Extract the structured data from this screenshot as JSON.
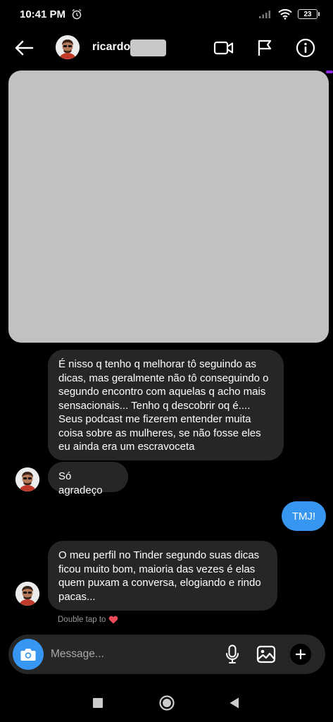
{
  "status_bar": {
    "time": "10:41 PM",
    "battery": "23",
    "icons": [
      "alarm-icon",
      "signal-icon",
      "wifi-icon",
      "battery-icon"
    ]
  },
  "header": {
    "contact_name": "ricardo",
    "icons": [
      "back-arrow-icon",
      "video-call-icon",
      "flag-icon",
      "info-icon"
    ]
  },
  "messages": [
    {
      "from": "contact",
      "text": "É nisso q tenho q melhorar tô seguindo as dicas, mas geralmente não tô conseguindo o segundo encontro com aquelas q acho mais sensacionais... Tenho q descobrir oq é.... Seus podcast me fizerem entender muita coisa sobre as mulheres, se não fosse eles eu ainda era um escravoceta"
    },
    {
      "from": "contact",
      "text": "Só agradeço"
    },
    {
      "from": "me",
      "text": "TMJ!"
    },
    {
      "from": "contact",
      "text": "O meu perfil no Tinder segundo suas dicas ficou muito bom, maioria das vezes é elas quem puxam a conversa, elogiando e rindo pacas..."
    }
  ],
  "hint": {
    "text": "Double tap to",
    "icon": "heart-icon"
  },
  "composer": {
    "placeholder": "Message...",
    "icons": [
      "camera-icon",
      "microphone-icon",
      "gallery-icon",
      "plus-icon"
    ]
  },
  "colors": {
    "accent": "#3797f0",
    "bubble": "#262626",
    "background": "#000000",
    "heart": "#ed4956"
  }
}
